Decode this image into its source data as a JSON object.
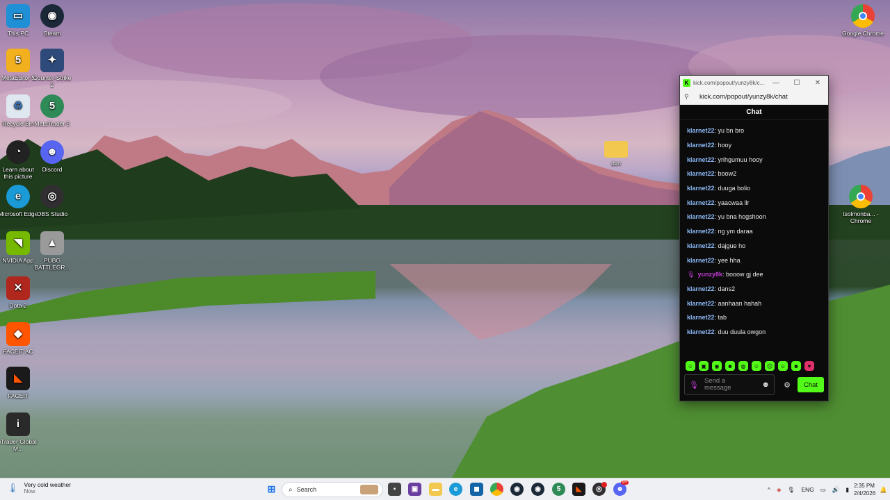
{
  "desktop": {
    "icons": [
      {
        "label": "This PC",
        "icon": "monitor-icon"
      },
      {
        "label": "Steam",
        "icon": "steam-icon"
      },
      {
        "label": "MetaEditor 5",
        "icon": "metaeditor-icon"
      },
      {
        "label": "Counter-Strike 2",
        "icon": "cs2-icon"
      },
      {
        "label": "Recycle Bin",
        "icon": "recycle-bin-icon"
      },
      {
        "label": "MetaTrader 5",
        "icon": "metatrader-icon"
      },
      {
        "label": "Learn about this picture",
        "icon": "learn-picture-icon"
      },
      {
        "label": "Discord",
        "icon": "discord-icon"
      },
      {
        "label": "Microsoft Edge",
        "icon": "edge-icon"
      },
      {
        "label": "OBS Studio",
        "icon": "obs-icon"
      },
      {
        "label": "NVIDIA App",
        "icon": "nvidia-icon"
      },
      {
        "label": "PUBG BATTLEGR...",
        "icon": "pubg-icon"
      },
      {
        "label": "Dota 2",
        "icon": "dota-icon"
      },
      {
        "label": "FACEIT AC",
        "icon": "faceit-ac-icon"
      },
      {
        "label": "FACEIT",
        "icon": "faceit-icon"
      },
      {
        "label": "iTrader Global M...",
        "icon": "itrader-icon"
      },
      {
        "label": "Google Chrome",
        "icon": "chrome-icon"
      },
      {
        "label": "dvn",
        "icon": "folder-icon"
      },
      {
        "label": "tsolmonba... - Chrome",
        "icon": "chrome-profile-icon"
      }
    ]
  },
  "chat_window": {
    "title": "kick.com/popout/yunzy8k/c...",
    "url": "kick.com/popout/yunzy8k/chat",
    "header": "Chat",
    "messages": [
      {
        "user": "klarnet22",
        "text": "yu bn bro"
      },
      {
        "user": "klarnet22",
        "text": "hooy"
      },
      {
        "user": "klarnet22",
        "text": "yrihgumuu hooy"
      },
      {
        "user": "klarnet22",
        "text": "boow2"
      },
      {
        "user": "klarnet22",
        "text": "duuga bolio"
      },
      {
        "user": "klarnet22",
        "text": "yaacwaa llr"
      },
      {
        "user": "klarnet22",
        "text": "yu bna hogshoon"
      },
      {
        "user": "klarnet22",
        "text": "ng ym daraa"
      },
      {
        "user": "klarnet22",
        "text": "dajgue ho"
      },
      {
        "user": "klarnet22",
        "text": "yee hha"
      },
      {
        "user": "yunzy8k",
        "text": "booow gj dee"
      },
      {
        "user": "klarnet22",
        "text": "dans2"
      },
      {
        "user": "klarnet22",
        "text": "aanhaan hahah"
      },
      {
        "user": "klarnet22",
        "text": "tab"
      },
      {
        "user": "klarnet22",
        "text": "duu duula owgon"
      }
    ],
    "input_placeholder": "Send a message",
    "send_label": "Chat",
    "accent": "#53fc18"
  },
  "taskbar": {
    "weather_title": "Very cold weather",
    "weather_sub": "Now",
    "search_label": "Search",
    "language": "ENG",
    "time": "2:35 PM",
    "date": "2/4/2026",
    "badges": {
      "discord": "9+"
    }
  }
}
